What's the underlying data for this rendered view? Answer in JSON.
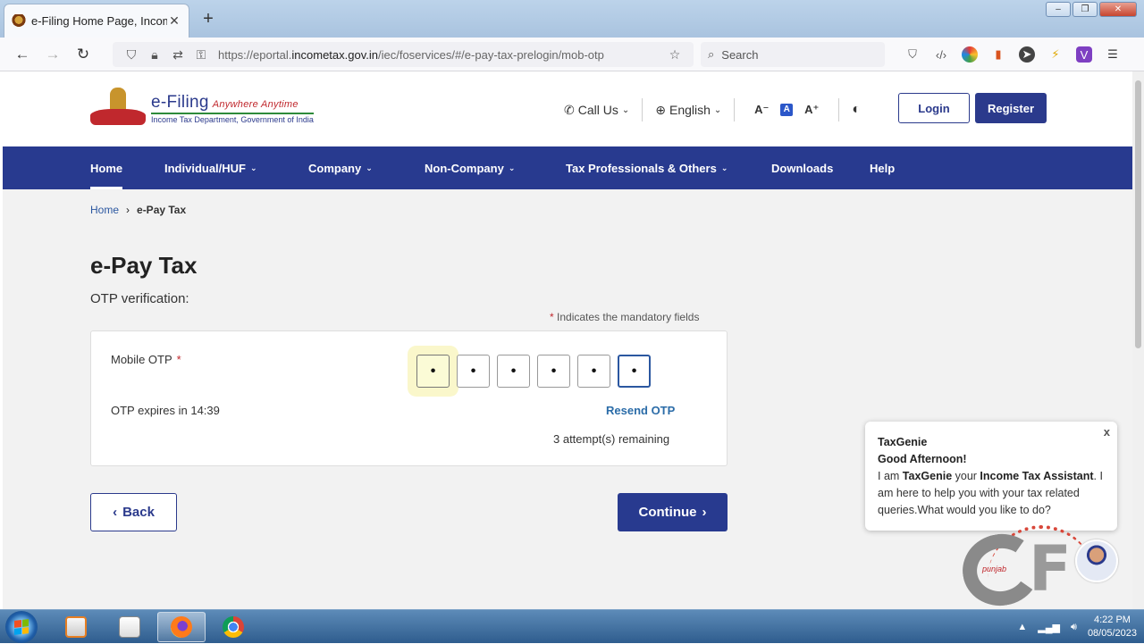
{
  "browser": {
    "tab_title": "e-Filing Home Page, Income Ta",
    "tab_close": "✕",
    "new_tab": "+",
    "url_prefix": "https://eportal.",
    "url_domain": "incometax.gov.in",
    "url_path": "/iec/foservices/#/e-pay-tax-prelogin/mob-otp",
    "search_placeholder": "Search"
  },
  "site": {
    "logo_title": "e-Filing",
    "logo_tagline": "Anywhere Anytime",
    "logo_subtitle": "Income Tax Department, Government of India",
    "call_us": "Call Us",
    "language": "English",
    "font_decrease": "A⁻",
    "font_normal": "A",
    "font_increase": "A⁺",
    "login": "Login",
    "register": "Register"
  },
  "nav": {
    "home": "Home",
    "individual": "Individual/HUF",
    "company": "Company",
    "non_company": "Non-Company",
    "tax_professionals": "Tax Professionals & Others",
    "downloads": "Downloads",
    "help": "Help"
  },
  "breadcrumb": {
    "home": "Home",
    "separator": "›",
    "current": "e-Pay Tax"
  },
  "main": {
    "title": "e-Pay Tax",
    "subtitle": "OTP verification:",
    "mandatory_star": "*",
    "mandatory_text": "Indicates the mandatory fields",
    "otp_label": "Mobile OTP",
    "otp_digits": [
      "•",
      "•",
      "•",
      "•",
      "•",
      "•"
    ],
    "otp_expiry": "OTP expires in 14:39",
    "resend": "Resend OTP",
    "attempts": "3 attempt(s) remaining",
    "back": "Back",
    "continue": "Continue"
  },
  "taxgenie": {
    "close": "x",
    "name": "TaxGenie",
    "greeting": "Good Afternoon!",
    "msg_pre": "I am ",
    "msg_name": "TaxGenie",
    "msg_mid": " your ",
    "msg_role": "Income Tax Assistant",
    "msg_post": ". I am here to help you with your tax related queries.What would you like to do?"
  },
  "watermark": {
    "text": "punjab"
  },
  "taskbar": {
    "time": "4:22 PM",
    "date": "08/05/2023"
  },
  "colors": {
    "brand_navy": "#283a8f",
    "link_blue": "#2b6ca8",
    "required_red": "#c0282d"
  }
}
